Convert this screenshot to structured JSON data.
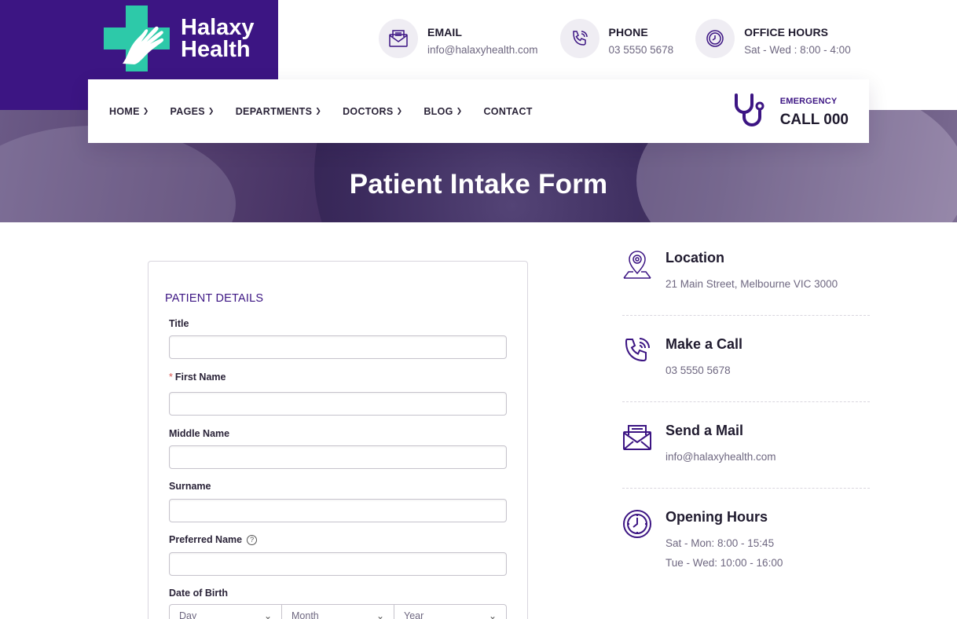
{
  "brand": {
    "name_line1": "Halaxy",
    "name_line2": "Health",
    "accent": "#3c1583",
    "logo_teal": "#2dc9a9"
  },
  "contact_bar": [
    {
      "icon": "envelope-icon",
      "label": "EMAIL",
      "value": "info@halaxyhealth.com"
    },
    {
      "icon": "phone-icon",
      "label": "PHONE",
      "value": "03 5550 5678"
    },
    {
      "icon": "clock-icon",
      "label": "OFFICE HOURS",
      "value": "Sat - Wed : 8:00 - 4:00"
    }
  ],
  "nav": {
    "items": [
      {
        "label": "HOME",
        "has_dropdown": true
      },
      {
        "label": "PAGES",
        "has_dropdown": true
      },
      {
        "label": "DEPARTMENTS",
        "has_dropdown": true
      },
      {
        "label": "DOCTORS",
        "has_dropdown": true
      },
      {
        "label": "BLOG",
        "has_dropdown": true
      },
      {
        "label": "CONTACT",
        "has_dropdown": false
      }
    ],
    "emergency_label": "EMERGENCY",
    "emergency_number": "CALL 000"
  },
  "hero": {
    "title": "Patient Intake Form"
  },
  "form": {
    "section_title": "PATIENT DETAILS",
    "fields": [
      {
        "label": "Title",
        "required": false,
        "value": ""
      },
      {
        "label": "First Name",
        "required": true,
        "value": ""
      },
      {
        "label": "Middle Name",
        "required": false,
        "value": ""
      },
      {
        "label": "Surname",
        "required": false,
        "value": ""
      },
      {
        "label": "Preferred Name",
        "required": false,
        "value": "",
        "help": true
      }
    ],
    "dob": {
      "label": "Date of Birth",
      "day": "Day",
      "month": "Month",
      "year": "Year"
    },
    "required_marker": "*",
    "help_glyph": "?"
  },
  "info": {
    "location": {
      "title": "Location",
      "value": "21 Main Street, Melbourne VIC 3000"
    },
    "call": {
      "title": "Make a Call",
      "value": "03 5550 5678"
    },
    "mail": {
      "title": "Send a Mail",
      "value": "info@halaxyhealth.com"
    },
    "hours": {
      "title": "Opening Hours",
      "line1": "Sat - Mon: 8:00 - 15:45",
      "line2": "Tue - Wed: 10:00 - 16:00"
    }
  }
}
